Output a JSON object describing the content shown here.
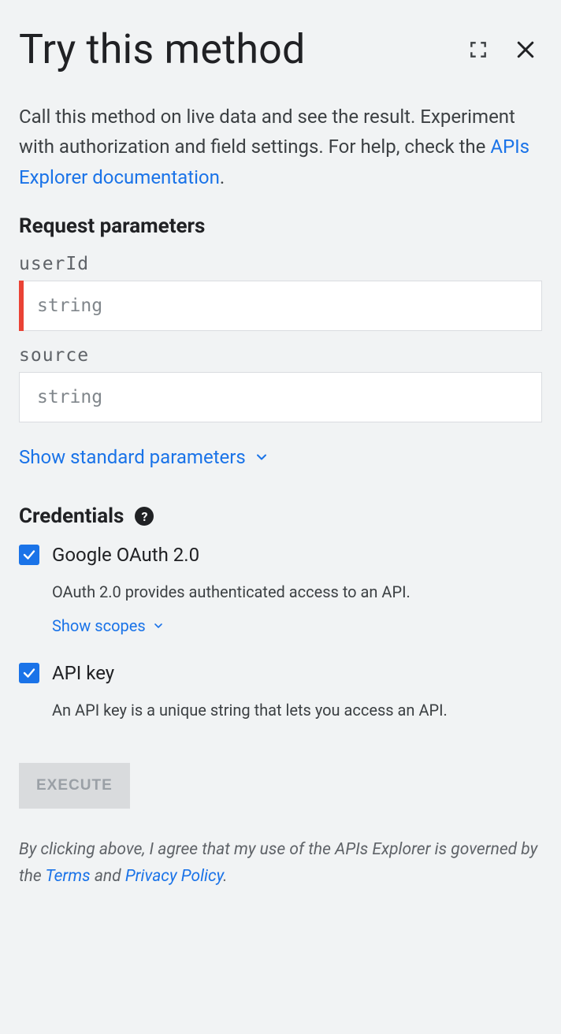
{
  "header": {
    "title": "Try this method"
  },
  "intro": {
    "text_before": "Call this method on live data and see the result. Experiment with authorization and field settings. For help, check the ",
    "link_text": "APIs Explorer documentation",
    "text_after": "."
  },
  "sections": {
    "request_parameters": "Request parameters",
    "credentials": "Credentials"
  },
  "params": {
    "userId": {
      "label": "userId",
      "placeholder": "string"
    },
    "source": {
      "label": "source",
      "placeholder": "string"
    }
  },
  "links": {
    "show_standard_params": "Show standard parameters",
    "show_scopes": "Show scopes"
  },
  "credentials": {
    "oauth": {
      "label": "Google OAuth 2.0",
      "desc": "OAuth 2.0 provides authenticated access to an API.",
      "checked": true
    },
    "apikey": {
      "label": "API key",
      "desc": "An API key is a unique string that lets you access an API.",
      "checked": true
    }
  },
  "actions": {
    "execute": "EXECUTE"
  },
  "disclaimer": {
    "before": "By clicking above, I agree that my use of the APIs Explorer is governed by the ",
    "terms": "Terms",
    "mid": " and ",
    "privacy": "Privacy Policy",
    "after": "."
  }
}
